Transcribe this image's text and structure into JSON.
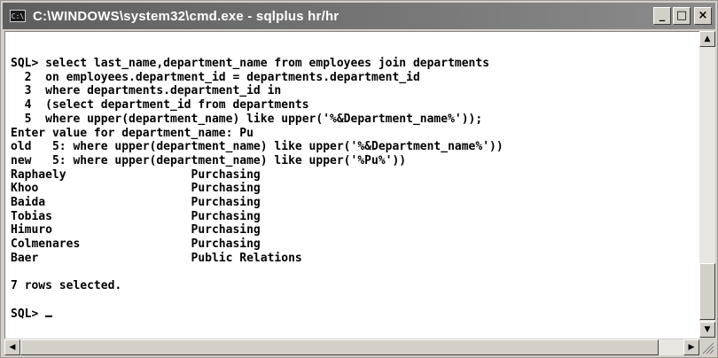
{
  "window": {
    "title": "C:\\WINDOWS\\system32\\cmd.exe - sqlplus hr/hr",
    "icon_label": "C:\\",
    "minimize_label": "_",
    "maximize_label": "□",
    "close_label": "×"
  },
  "console": {
    "lines": [
      "SQL> select last_name,department_name from employees join departments",
      "  2  on employees.department_id = departments.department_id",
      "  3  where departments.department_id in",
      "  4  (select department_id from departments",
      "  5  where upper(department_name) like upper('%&Department_name%'));",
      "Enter value for department_name: Pu",
      "old   5: where upper(department_name) like upper('%&Department_name%'))",
      "new   5: where upper(department_name) like upper('%Pu%'))",
      "Raphaely                  Purchasing",
      "Khoo                      Purchasing",
      "Baida                     Purchasing",
      "Tobias                    Purchasing",
      "Himuro                    Purchasing",
      "Colmenares                Purchasing",
      "Baer                      Public Relations",
      "",
      "7 rows selected.",
      "",
      "SQL> "
    ]
  },
  "scrollbars": {
    "up_arrow": "▲",
    "down_arrow": "▼",
    "left_arrow": "◀",
    "right_arrow": "▶"
  }
}
